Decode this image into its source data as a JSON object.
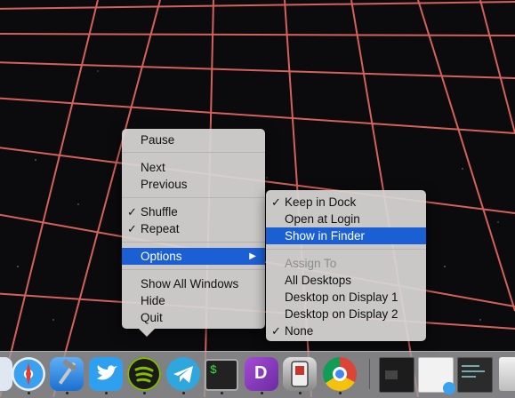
{
  "app_menu": {
    "items": [
      {
        "label": "Pause"
      },
      {
        "label": "Next"
      },
      {
        "label": "Previous"
      },
      {
        "label": "Shuffle",
        "check": "✓"
      },
      {
        "label": "Repeat",
        "check": "✓"
      },
      {
        "label": "Options",
        "arrow": "▶"
      },
      {
        "label": "Show All Windows"
      },
      {
        "label": "Hide"
      },
      {
        "label": "Quit"
      }
    ]
  },
  "options_menu": {
    "items": [
      {
        "label": "Keep in Dock",
        "check": "✓"
      },
      {
        "label": "Open at Login"
      },
      {
        "label": "Show in Finder"
      },
      {
        "label": "Assign To"
      },
      {
        "label": "All Desktops"
      },
      {
        "label": "Desktop on Display 1"
      },
      {
        "label": "Desktop on Display 2"
      },
      {
        "label": "None",
        "check": "✓"
      }
    ]
  },
  "dock": {
    "apps": [
      {
        "name": "finder-icon"
      },
      {
        "name": "safari-icon"
      },
      {
        "name": "xcode-icon"
      },
      {
        "name": "twitter-icon"
      },
      {
        "name": "spotify-icon"
      },
      {
        "name": "telegram-icon"
      },
      {
        "name": "terminal-icon",
        "text": "$"
      },
      {
        "name": "dash-icon",
        "text": "D"
      },
      {
        "name": "transmit-icon"
      },
      {
        "name": "chrome-icon"
      },
      {
        "name": "window-thumb-dark-icon"
      },
      {
        "name": "window-thumb-light-icon"
      },
      {
        "name": "window-thumb-code-icon"
      },
      {
        "name": "trash-icon"
      }
    ]
  },
  "colors": {
    "highlight": "#1b5fd4",
    "menu_bg": "#d6d4d2",
    "grid_line": "#e0665f"
  }
}
